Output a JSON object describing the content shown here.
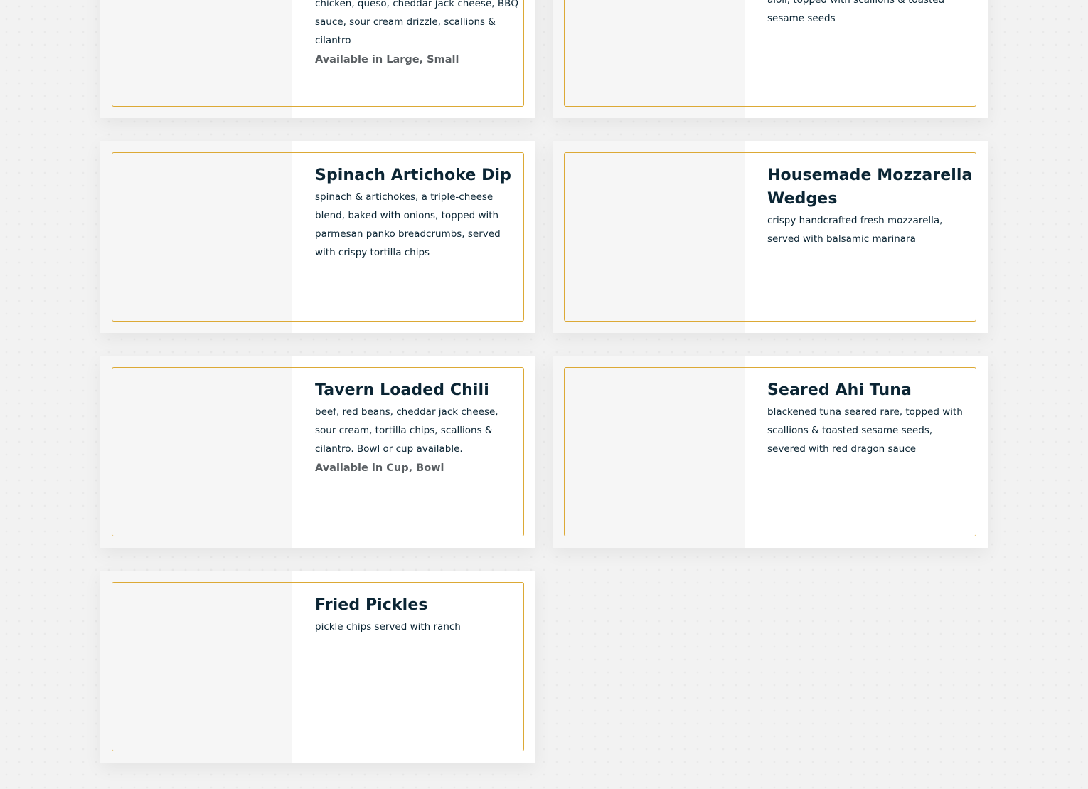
{
  "menu_items": [
    {
      "title": "",
      "description": "chicken, queso, cheddar jack cheese, BBQ sauce, sour cream drizzle, scallions & cilantro",
      "availability": "Available in Large, Small"
    },
    {
      "title": "",
      "description": "aioli, topped with scallions & toasted sesame seeds",
      "availability": ""
    },
    {
      "title": "Spinach Artichoke Dip",
      "description": "spinach & artichokes, a triple-cheese blend, baked with onions, topped with parmesan panko breadcrumbs, served with crispy tortilla chips",
      "availability": ""
    },
    {
      "title": "Housemade Mozzarella Wedges",
      "description": "crispy handcrafted fresh mozzarella, served with balsamic marinara",
      "availability": ""
    },
    {
      "title": "Tavern Loaded Chili",
      "description": "beef, red beans, cheddar jack cheese, sour cream, tortilla chips, scallions & cilantro. Bowl or cup available.",
      "availability": "Available in Cup, Bowl"
    },
    {
      "title": "Seared Ahi Tuna",
      "description": "blackened tuna seared rare, topped with scallions & toasted sesame seeds, severed with red dragon sauce",
      "availability": ""
    },
    {
      "title": "Fried Pickles",
      "description": "pickle chips served with ranch",
      "availability": ""
    }
  ],
  "colors": {
    "frame_border": "#dca935",
    "title_text": "#0b2534",
    "availability_text": "#5a5f63",
    "card_background": "#ffffff",
    "page_background": "#f2f2f2"
  }
}
